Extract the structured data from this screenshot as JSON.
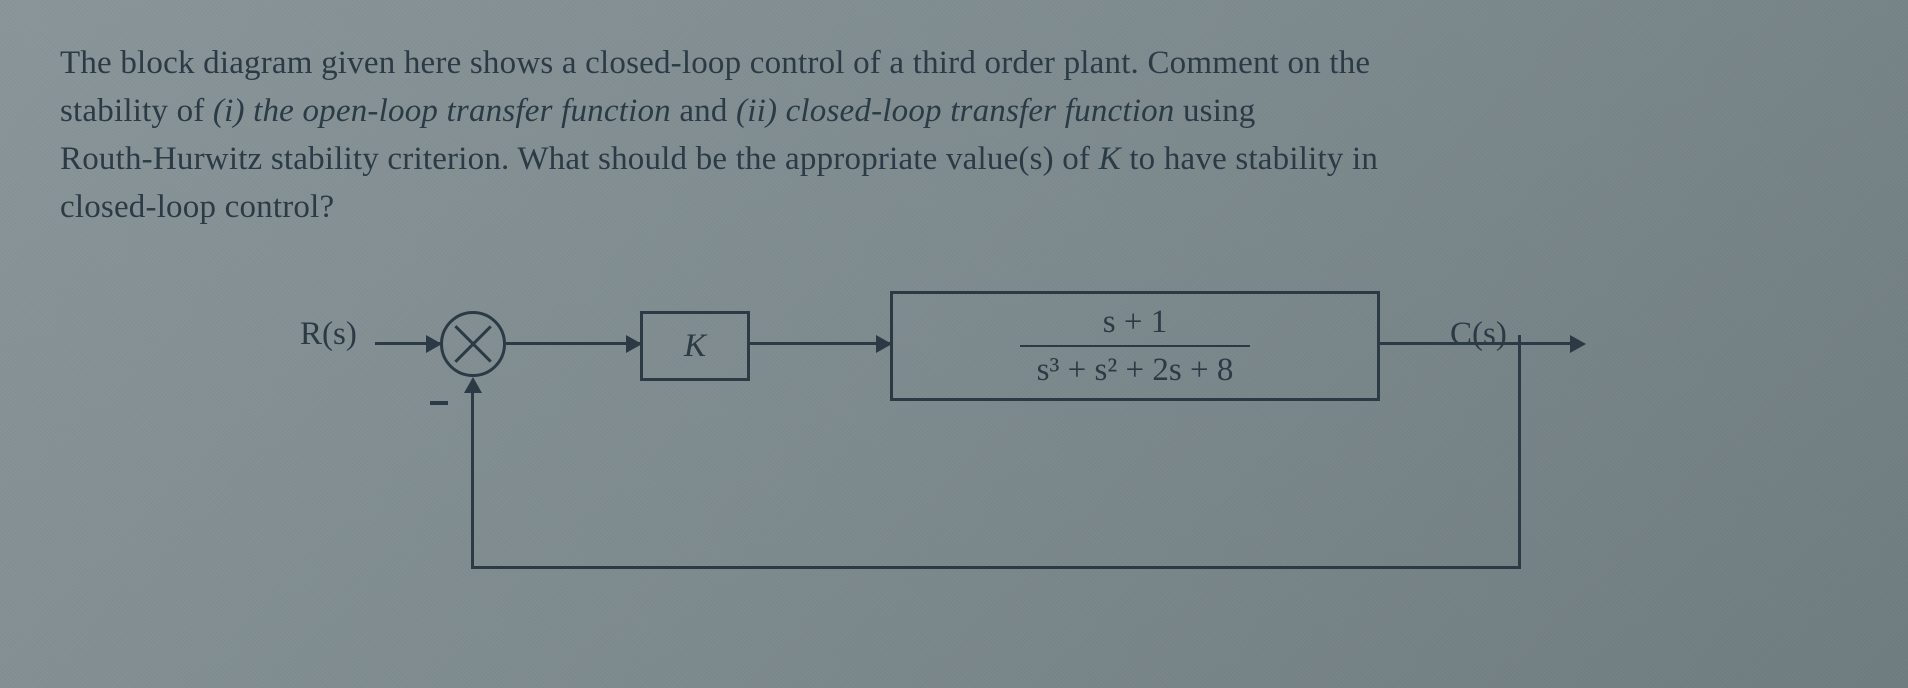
{
  "question": {
    "line1_a": "The block diagram given here shows a closed-loop control of a third order plant. Comment on the",
    "line2_a": "stability of ",
    "part_i": "(i) the open-loop transfer function",
    "and": " and ",
    "part_ii": "(ii) closed-loop transfer function",
    "using": " using",
    "line3_a": "Routh-Hurwitz stability criterion. What should be the appropriate value(s) of ",
    "K_var": "K",
    "line3_b": " to have stability in",
    "line4": "closed-loop control?"
  },
  "diagram": {
    "input_label": "R(s)",
    "output_label": "C(s)",
    "gain_label": "K",
    "plant": {
      "numerator": "s + 1",
      "denominator_html": "s³ + s² + 2s + 8"
    }
  }
}
